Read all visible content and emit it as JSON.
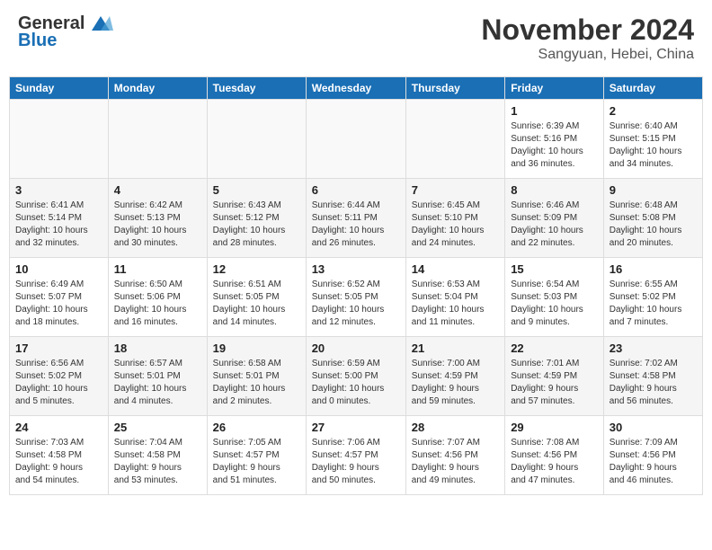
{
  "header": {
    "logo_general": "General",
    "logo_blue": "Blue",
    "month": "November 2024",
    "location": "Sangyuan, Hebei, China"
  },
  "weekdays": [
    "Sunday",
    "Monday",
    "Tuesday",
    "Wednesday",
    "Thursday",
    "Friday",
    "Saturday"
  ],
  "weeks": [
    [
      {
        "day": "",
        "info": ""
      },
      {
        "day": "",
        "info": ""
      },
      {
        "day": "",
        "info": ""
      },
      {
        "day": "",
        "info": ""
      },
      {
        "day": "",
        "info": ""
      },
      {
        "day": "1",
        "info": "Sunrise: 6:39 AM\nSunset: 5:16 PM\nDaylight: 10 hours\nand 36 minutes."
      },
      {
        "day": "2",
        "info": "Sunrise: 6:40 AM\nSunset: 5:15 PM\nDaylight: 10 hours\nand 34 minutes."
      }
    ],
    [
      {
        "day": "3",
        "info": "Sunrise: 6:41 AM\nSunset: 5:14 PM\nDaylight: 10 hours\nand 32 minutes."
      },
      {
        "day": "4",
        "info": "Sunrise: 6:42 AM\nSunset: 5:13 PM\nDaylight: 10 hours\nand 30 minutes."
      },
      {
        "day": "5",
        "info": "Sunrise: 6:43 AM\nSunset: 5:12 PM\nDaylight: 10 hours\nand 28 minutes."
      },
      {
        "day": "6",
        "info": "Sunrise: 6:44 AM\nSunset: 5:11 PM\nDaylight: 10 hours\nand 26 minutes."
      },
      {
        "day": "7",
        "info": "Sunrise: 6:45 AM\nSunset: 5:10 PM\nDaylight: 10 hours\nand 24 minutes."
      },
      {
        "day": "8",
        "info": "Sunrise: 6:46 AM\nSunset: 5:09 PM\nDaylight: 10 hours\nand 22 minutes."
      },
      {
        "day": "9",
        "info": "Sunrise: 6:48 AM\nSunset: 5:08 PM\nDaylight: 10 hours\nand 20 minutes."
      }
    ],
    [
      {
        "day": "10",
        "info": "Sunrise: 6:49 AM\nSunset: 5:07 PM\nDaylight: 10 hours\nand 18 minutes."
      },
      {
        "day": "11",
        "info": "Sunrise: 6:50 AM\nSunset: 5:06 PM\nDaylight: 10 hours\nand 16 minutes."
      },
      {
        "day": "12",
        "info": "Sunrise: 6:51 AM\nSunset: 5:05 PM\nDaylight: 10 hours\nand 14 minutes."
      },
      {
        "day": "13",
        "info": "Sunrise: 6:52 AM\nSunset: 5:05 PM\nDaylight: 10 hours\nand 12 minutes."
      },
      {
        "day": "14",
        "info": "Sunrise: 6:53 AM\nSunset: 5:04 PM\nDaylight: 10 hours\nand 11 minutes."
      },
      {
        "day": "15",
        "info": "Sunrise: 6:54 AM\nSunset: 5:03 PM\nDaylight: 10 hours\nand 9 minutes."
      },
      {
        "day": "16",
        "info": "Sunrise: 6:55 AM\nSunset: 5:02 PM\nDaylight: 10 hours\nand 7 minutes."
      }
    ],
    [
      {
        "day": "17",
        "info": "Sunrise: 6:56 AM\nSunset: 5:02 PM\nDaylight: 10 hours\nand 5 minutes."
      },
      {
        "day": "18",
        "info": "Sunrise: 6:57 AM\nSunset: 5:01 PM\nDaylight: 10 hours\nand 4 minutes."
      },
      {
        "day": "19",
        "info": "Sunrise: 6:58 AM\nSunset: 5:01 PM\nDaylight: 10 hours\nand 2 minutes."
      },
      {
        "day": "20",
        "info": "Sunrise: 6:59 AM\nSunset: 5:00 PM\nDaylight: 10 hours\nand 0 minutes."
      },
      {
        "day": "21",
        "info": "Sunrise: 7:00 AM\nSunset: 4:59 PM\nDaylight: 9 hours\nand 59 minutes."
      },
      {
        "day": "22",
        "info": "Sunrise: 7:01 AM\nSunset: 4:59 PM\nDaylight: 9 hours\nand 57 minutes."
      },
      {
        "day": "23",
        "info": "Sunrise: 7:02 AM\nSunset: 4:58 PM\nDaylight: 9 hours\nand 56 minutes."
      }
    ],
    [
      {
        "day": "24",
        "info": "Sunrise: 7:03 AM\nSunset: 4:58 PM\nDaylight: 9 hours\nand 54 minutes."
      },
      {
        "day": "25",
        "info": "Sunrise: 7:04 AM\nSunset: 4:58 PM\nDaylight: 9 hours\nand 53 minutes."
      },
      {
        "day": "26",
        "info": "Sunrise: 7:05 AM\nSunset: 4:57 PM\nDaylight: 9 hours\nand 51 minutes."
      },
      {
        "day": "27",
        "info": "Sunrise: 7:06 AM\nSunset: 4:57 PM\nDaylight: 9 hours\nand 50 minutes."
      },
      {
        "day": "28",
        "info": "Sunrise: 7:07 AM\nSunset: 4:56 PM\nDaylight: 9 hours\nand 49 minutes."
      },
      {
        "day": "29",
        "info": "Sunrise: 7:08 AM\nSunset: 4:56 PM\nDaylight: 9 hours\nand 47 minutes."
      },
      {
        "day": "30",
        "info": "Sunrise: 7:09 AM\nSunset: 4:56 PM\nDaylight: 9 hours\nand 46 minutes."
      }
    ]
  ]
}
